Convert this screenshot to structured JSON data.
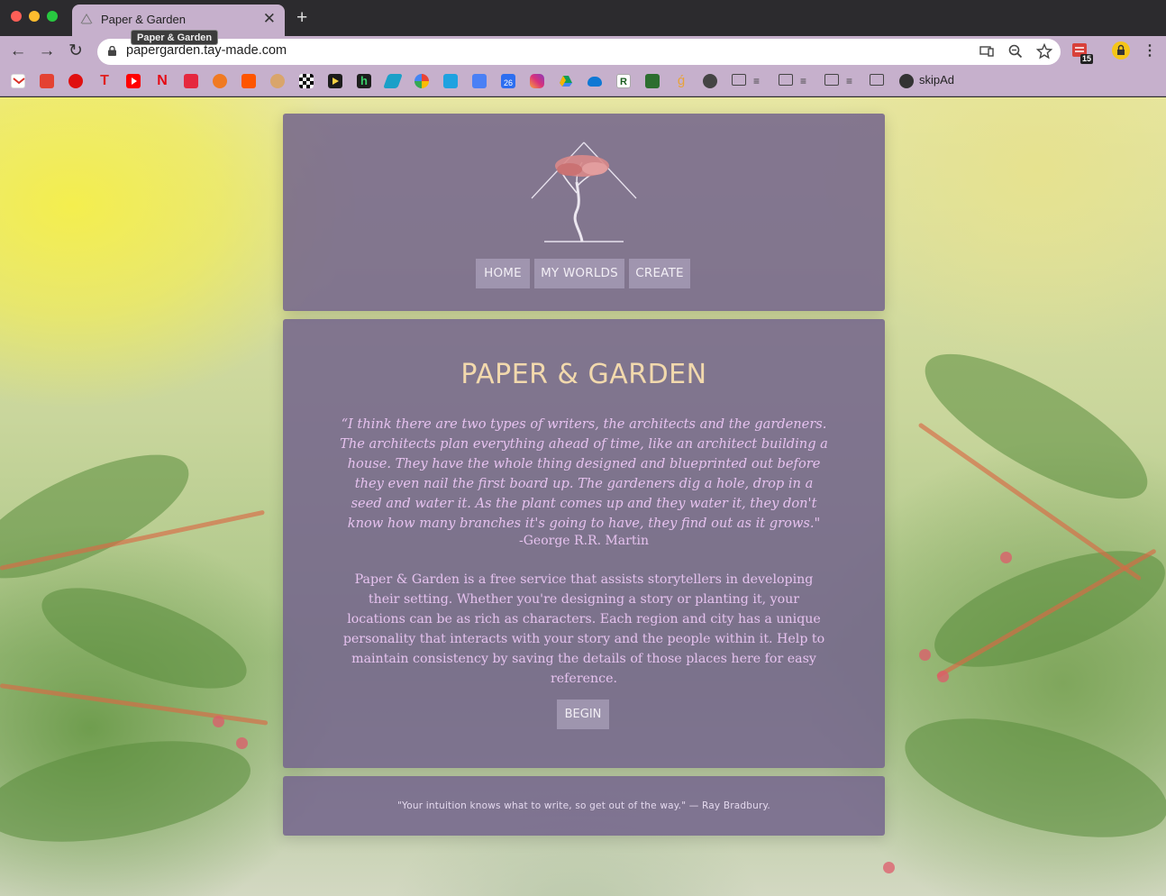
{
  "browser": {
    "tab_title": "Paper & Garden",
    "tooltip": "Paper & Garden",
    "url": "papergarden.tay-made.com",
    "extension_badge": "15",
    "bookmarks_text_item": "skipAd"
  },
  "site": {
    "nav": [
      "HOME",
      "MY WORLDS",
      "CREATE"
    ],
    "title": "PAPER & GARDEN",
    "quote": "“I think there are two types of writers, the architects and the gardeners. The architects plan everything ahead of time, like an architect building a house. They have the whole thing designed and blueprinted out before they even nail the first board up. The gardeners dig a hole, drop in a seed and water it. As the plant comes up and they water it, they don't know how many branches it's going to have, they find out as it grows.\"",
    "quote_attribution": "-George R.R. Martin",
    "description": "Paper & Garden is a free service that assists storytellers in developing their setting. Whether you're designing a story or planting it, your locations can be as rich as characters. Each region and city has a unique personality that interacts with your story and the people within it. Help to maintain consistency by saving the details of those places here for easy reference.",
    "begin_label": "BEGIN",
    "footer_quote": "\"Your intuition knows what to write, so get out of the way.\" — Ray Bradbury."
  },
  "colors": {
    "chrome": "#c6b0cc",
    "panel": "#73648c",
    "title": "#f2d9ad",
    "body_text": "#e6c2ef"
  },
  "icons": {
    "toolbar": [
      "back-icon",
      "forward-icon",
      "reload-icon",
      "lock-icon",
      "cast-icon",
      "zoom-icon",
      "star-icon",
      "extension-icon",
      "extension-lock-icon",
      "menu-icon"
    ],
    "bookmarks": [
      "gmail",
      "todoist",
      "red-circle",
      "t-app",
      "youtube",
      "netflix",
      "app-a",
      "gear-app",
      "soundcloud",
      "avatar-app",
      "checkers-app",
      "play-app",
      "h-app",
      "stripe-app",
      "photos",
      "pinwheel-app",
      "calendar-doc",
      "calendar-26",
      "instagram",
      "google-drive",
      "onedrive",
      "r-app",
      "g-app",
      "ornament-app",
      "github",
      "folder",
      "folder",
      "folder",
      "folder",
      "globe"
    ]
  }
}
